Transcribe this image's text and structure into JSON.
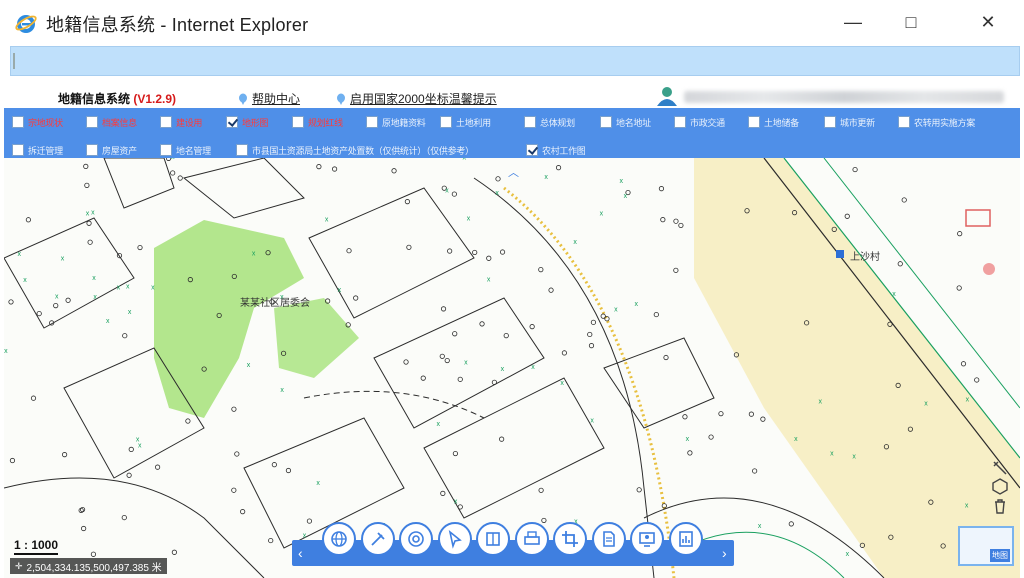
{
  "window": {
    "title": "地籍信息系统 - Internet Explorer",
    "minimize": "—",
    "maximize": "□",
    "close": "✕"
  },
  "address_bar": {
    "value": ""
  },
  "header": {
    "system_name": "地籍信息系统",
    "version": "(V1.2.9)",
    "help_link": "帮助中心",
    "notice_link": "启用国家2000坐标温馨提示"
  },
  "layers": [
    {
      "label": "宗地现状",
      "checked": false,
      "color": "#ff3a3a"
    },
    {
      "label": "档案信息",
      "checked": false,
      "color": "#ff3a3a"
    },
    {
      "label": "建设用",
      "checked": false,
      "color": "#ff3a3a"
    },
    {
      "label": "地形图",
      "checked": true,
      "color": "#ff3a3a"
    },
    {
      "label": "规划红线",
      "checked": false,
      "color": "#ff3a3a"
    },
    {
      "label": "原地籍资料",
      "checked": false,
      "color": "#ffffff"
    },
    {
      "label": "土地利用",
      "checked": false,
      "color": "#ffffff"
    },
    {
      "label": "总体规划",
      "checked": false,
      "color": "#ffffff"
    },
    {
      "label": "地名地址",
      "checked": false,
      "color": "#ffffff"
    },
    {
      "label": "市政交通",
      "checked": false,
      "color": "#ffffff"
    },
    {
      "label": "土地储备",
      "checked": false,
      "color": "#ffffff"
    },
    {
      "label": "城市更新",
      "checked": false,
      "color": "#ffffff"
    },
    {
      "label": "农转用实施方案",
      "checked": false,
      "color": "#ffffff"
    },
    {
      "label": "拆迁管理",
      "checked": false,
      "color": "#ffffff"
    },
    {
      "label": "房屋资产",
      "checked": false,
      "color": "#ffffff"
    },
    {
      "label": "地名管理",
      "checked": false,
      "color": "#ffffff"
    },
    {
      "label": "市县国土资源局土地资产处置数（仅供统计）（仅供参考）",
      "checked": false,
      "color": "#ffffff"
    },
    {
      "label": "农村工作图",
      "checked": true,
      "color": "#ffffff"
    }
  ],
  "map": {
    "poi_1": "某某社区居委会",
    "poi_2": "上沙村",
    "scale": "1 : 1000",
    "coordinates": "2,504,334.135,500,497.385 米"
  },
  "toolbar": {
    "tools": [
      {
        "icon": "globe-icon"
      },
      {
        "icon": "pin-icon"
      },
      {
        "icon": "search-circle-icon"
      },
      {
        "icon": "pointer-icon"
      },
      {
        "icon": "book-icon"
      },
      {
        "icon": "print-icon"
      },
      {
        "icon": "crop-icon"
      },
      {
        "icon": "document-icon"
      },
      {
        "icon": "monitor-person-icon"
      },
      {
        "icon": "chart-doc-icon"
      }
    ],
    "left_arrow": "‹",
    "right_arrow": "›"
  },
  "minimap": {
    "label": "地图"
  },
  "colors": {
    "layer_bar": "#4f8fe8",
    "toolbar": "#3f7fe0",
    "vegetation": "#a6e27a",
    "road_belt": "#f7efc6",
    "line": "#2b2b2b"
  }
}
